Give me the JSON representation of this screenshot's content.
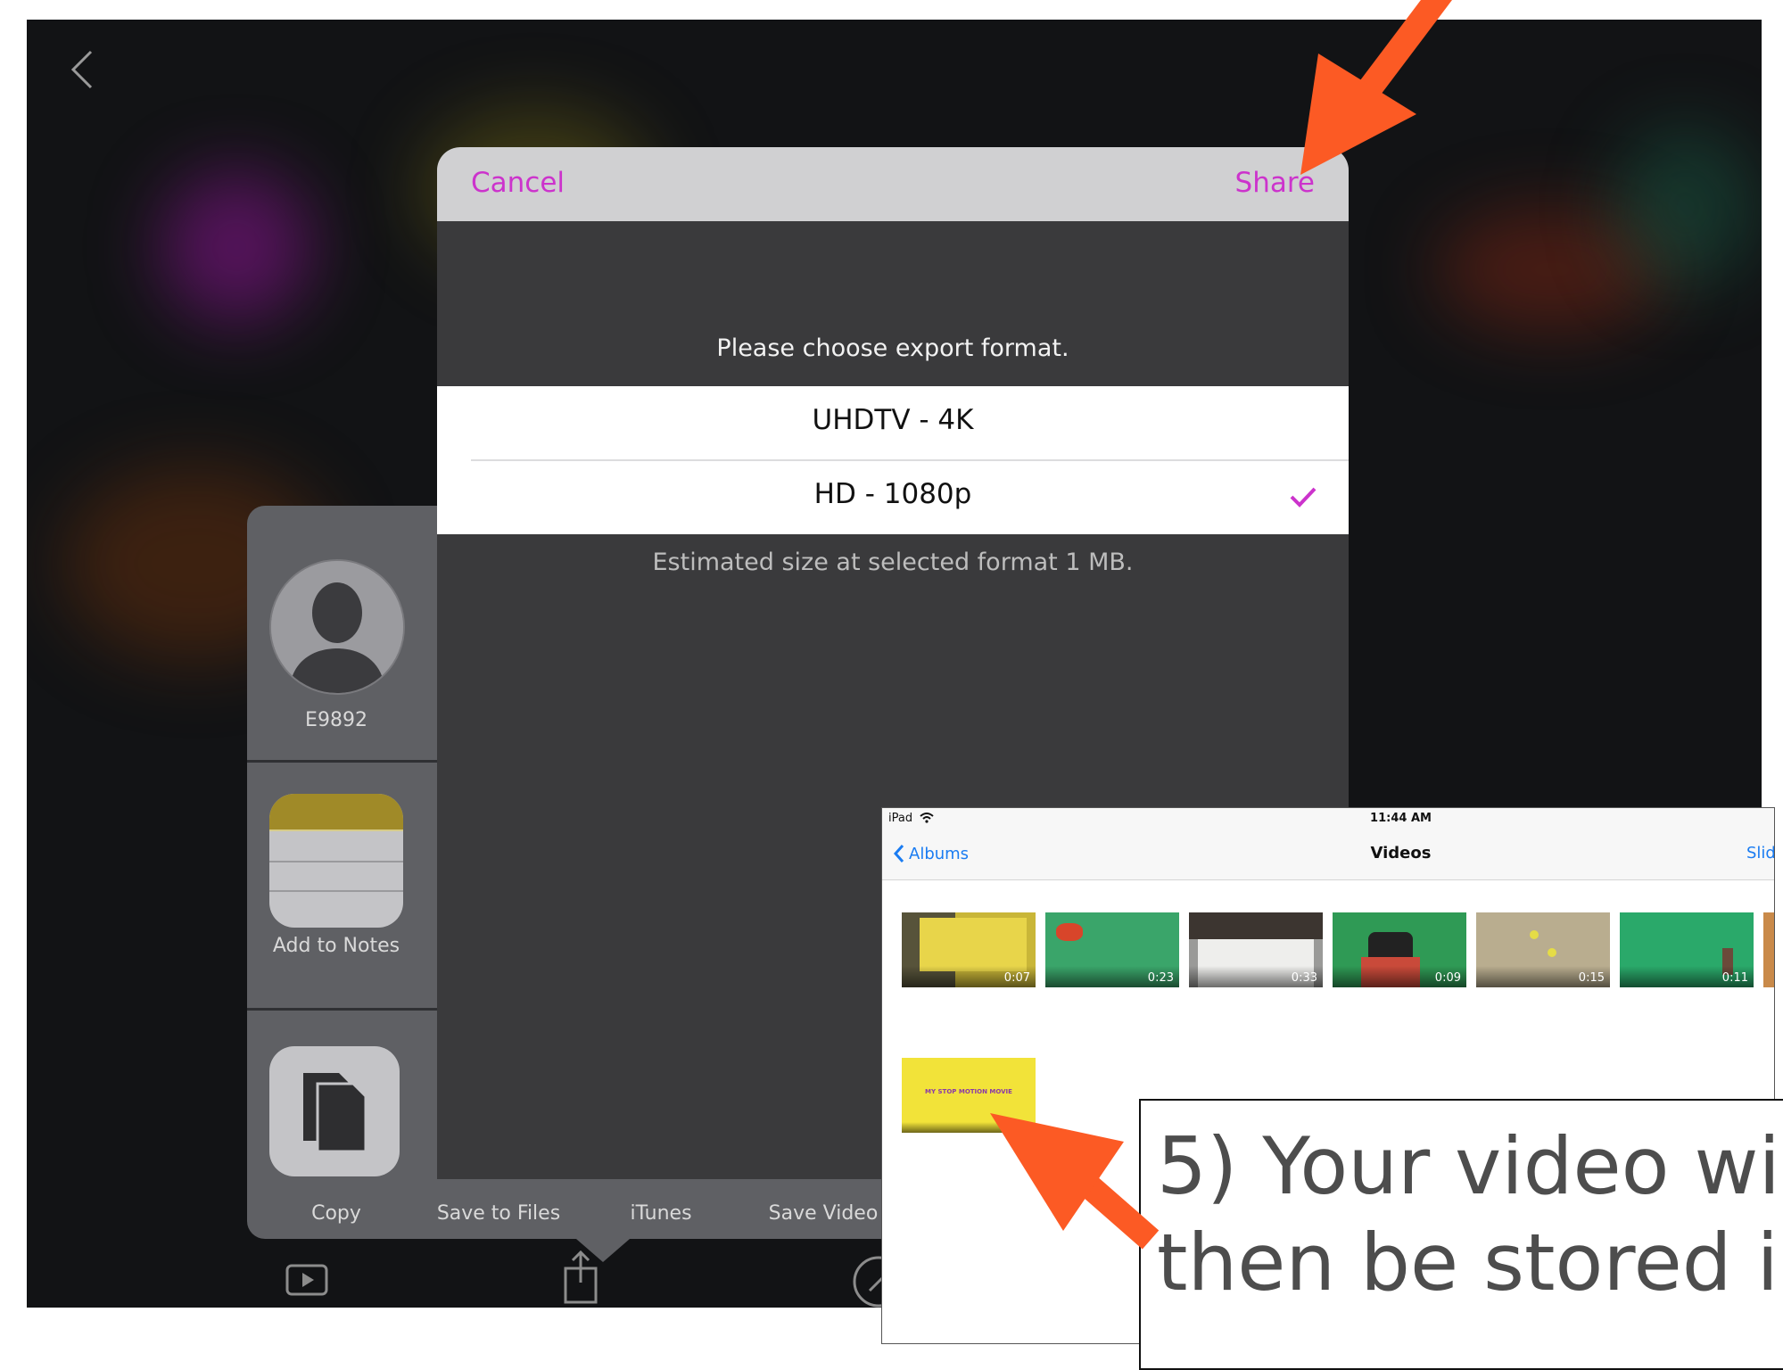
{
  "export_dialog": {
    "cancel_label": "Cancel",
    "share_label": "Share",
    "prompt": "Please choose export format.",
    "formats": [
      {
        "label": "UHDTV - 4K",
        "selected": false
      },
      {
        "label": "HD - 1080p",
        "selected": true
      }
    ],
    "size_estimate": "Estimated size at selected format 1 MB.",
    "accent_color": "#cc33cc"
  },
  "share_sheet": {
    "contact_name": "E9892",
    "actions": [
      {
        "label": "Add to Notes",
        "icon": "notes-icon"
      },
      {
        "label": "Copy",
        "icon": "copy-icon"
      },
      {
        "label": "Save to Files",
        "icon": "folder-icon"
      },
      {
        "label": "iTunes",
        "icon": "itunes-icon"
      },
      {
        "label": "Save Video",
        "icon": "save-video-icon"
      }
    ]
  },
  "photos_app": {
    "device": "iPad",
    "time": "11:44 AM",
    "back_label": "Albums",
    "title": "Videos",
    "right_action": "Slide",
    "thumbnails": [
      {
        "duration": "0:07",
        "color": "#c9b638"
      },
      {
        "duration": "0:23",
        "color": "#3aa56a"
      },
      {
        "duration": "0:33",
        "color": "#9a9a98"
      },
      {
        "duration": "0:09",
        "color": "#2f9a55"
      },
      {
        "duration": "0:15",
        "color": "#b9ad8f"
      },
      {
        "duration": "0:11",
        "color": "#2aa96a"
      },
      {
        "duration": "",
        "color": "#c98a4a"
      }
    ],
    "new_video_title": "MY STOP MOTION MOVIE"
  },
  "caption": {
    "line1": "5) Your video wi",
    "line2": "then be stored in"
  },
  "annotation_color": "#fc5a24"
}
